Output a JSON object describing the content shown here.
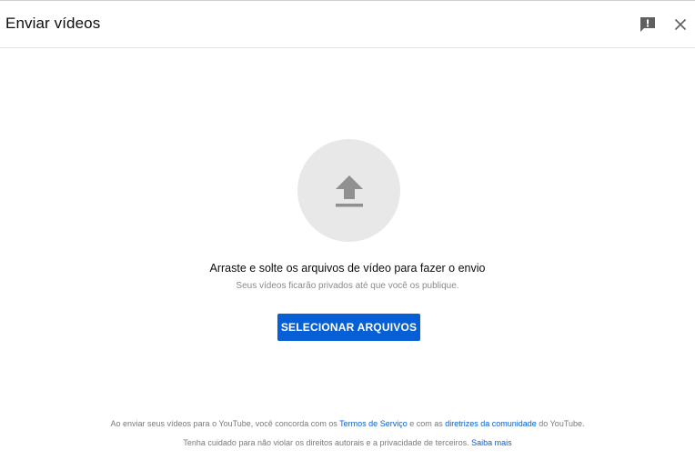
{
  "dialog": {
    "title": "Enviar vídeos",
    "feedback_icon": "feedback-icon",
    "close_icon": "close-icon"
  },
  "upload": {
    "icon": "upload-arrow-icon",
    "primary_text": "Arraste e solte os arquivos de vídeo para fazer o envio",
    "secondary_text": "Seus vídeos ficarão privados até que você os publique.",
    "button_label": "SELECIONAR ARQUIVOS"
  },
  "footer": {
    "line1_prefix": "Ao enviar seus vídeos para o YouTube, você concorda com os ",
    "terms_link": "Termos de Serviço",
    "line1_middle": " e com as ",
    "guidelines_link": "diretrizes da comunidade",
    "line1_suffix": " do YouTube.",
    "line2_text": "Tenha cuidado para não violar os direitos autorais e a privacidade de terceiros. ",
    "learn_more_link": "Saiba mais"
  },
  "colors": {
    "accent": "#065fd4",
    "circle_bg": "#e8e8e8",
    "icon_gray": "#909090"
  }
}
